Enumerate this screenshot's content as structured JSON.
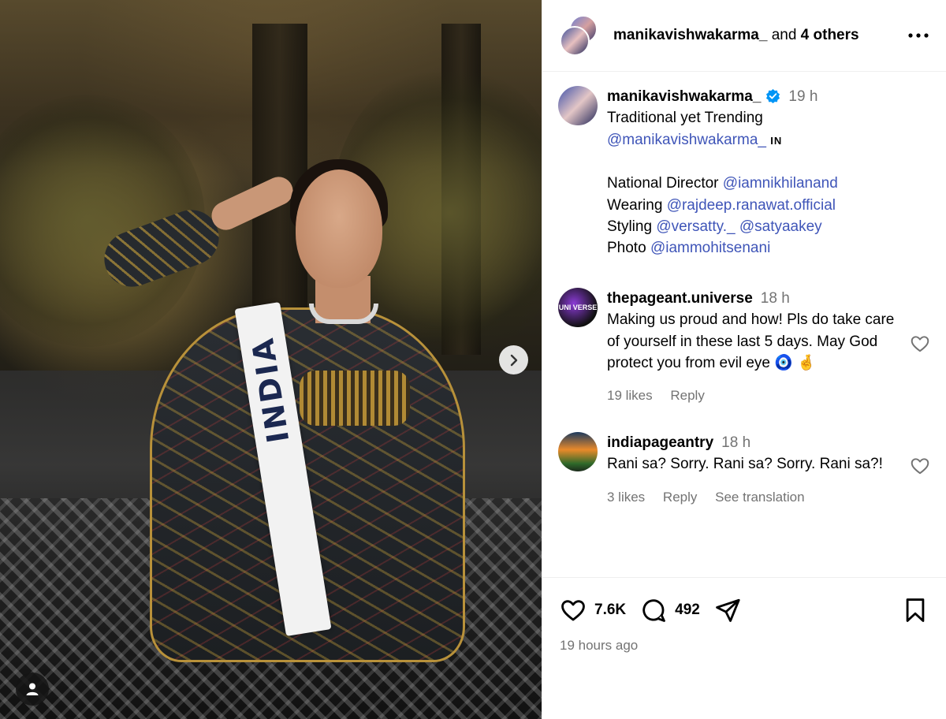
{
  "media": {
    "sash_text": "INDIA"
  },
  "header": {
    "username": "manikavishwakarma_",
    "and_text": "and",
    "others": "4 others"
  },
  "caption": {
    "username": "manikavishwakarma_",
    "time": "19 h",
    "line1": "Traditional yet Trending",
    "mention1": "@manikavishwakarma_",
    "country_code": "IN",
    "director_label": "National Director",
    "director_mention": "@iamnikhilanand",
    "wearing_label": "Wearing",
    "wearing_mention": "@rajdeep.ranawat.official",
    "styling_label": "Styling",
    "styling_mention1": "@versatty._",
    "styling_mention2": "@satyaakey",
    "photo_label": "Photo",
    "photo_mention": "@iammohitsenani"
  },
  "comments": [
    {
      "username": "thepageant.universe",
      "time": "18 h",
      "avatar_text": "UNI VERSE",
      "text": "Making us proud and how! Pls do take care of yourself in these last 5 days. May God protect you from evil eye 🧿 🤞",
      "likes": "19 likes",
      "reply": "Reply"
    },
    {
      "username": "indiapageantry",
      "time": "18 h",
      "text": "Rani sa? Sorry. Rani sa? Sorry. Rani sa?!",
      "likes": "3 likes",
      "reply": "Reply",
      "translate": "See translation"
    }
  ],
  "actions": {
    "likes_count": "7.6K",
    "comments_count": "492",
    "posted": "19 hours ago"
  },
  "colors": {
    "link": "#3f55b8",
    "muted": "#737373",
    "verified": "#0095f6"
  }
}
